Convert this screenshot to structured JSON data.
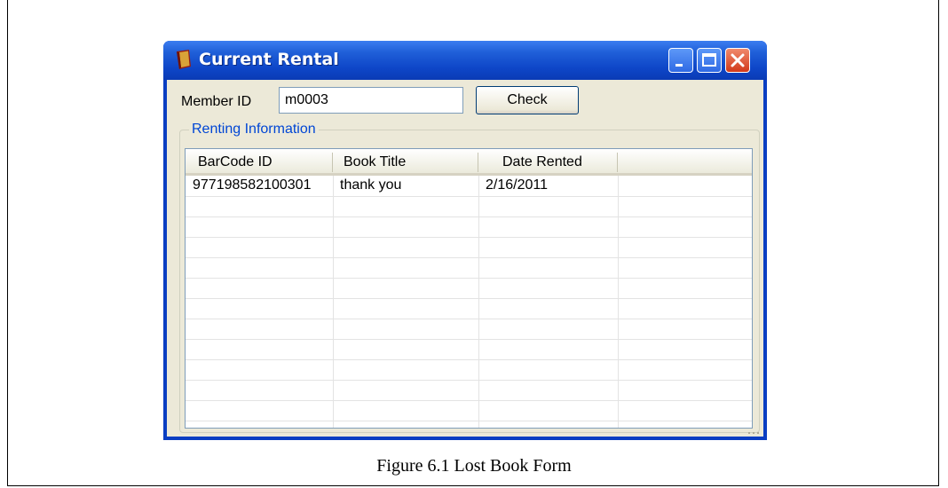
{
  "window": {
    "title": "Current Rental",
    "icon": "book-icon"
  },
  "form": {
    "member_label": "Member ID",
    "member_value": "m0003",
    "check_label": "Check"
  },
  "group": {
    "legend": "Renting Information"
  },
  "table": {
    "columns": [
      "BarCode ID",
      "Book Title",
      "Date Rented",
      ""
    ],
    "rows": [
      [
        "977198582100301",
        "thank you",
        "2/16/2011",
        ""
      ]
    ]
  },
  "caption": "Figure 6.1 Lost Book Form",
  "colors": {
    "titlebar": "#0a3ec2",
    "client": "#ece9d8",
    "legend_text": "#0046d5"
  }
}
